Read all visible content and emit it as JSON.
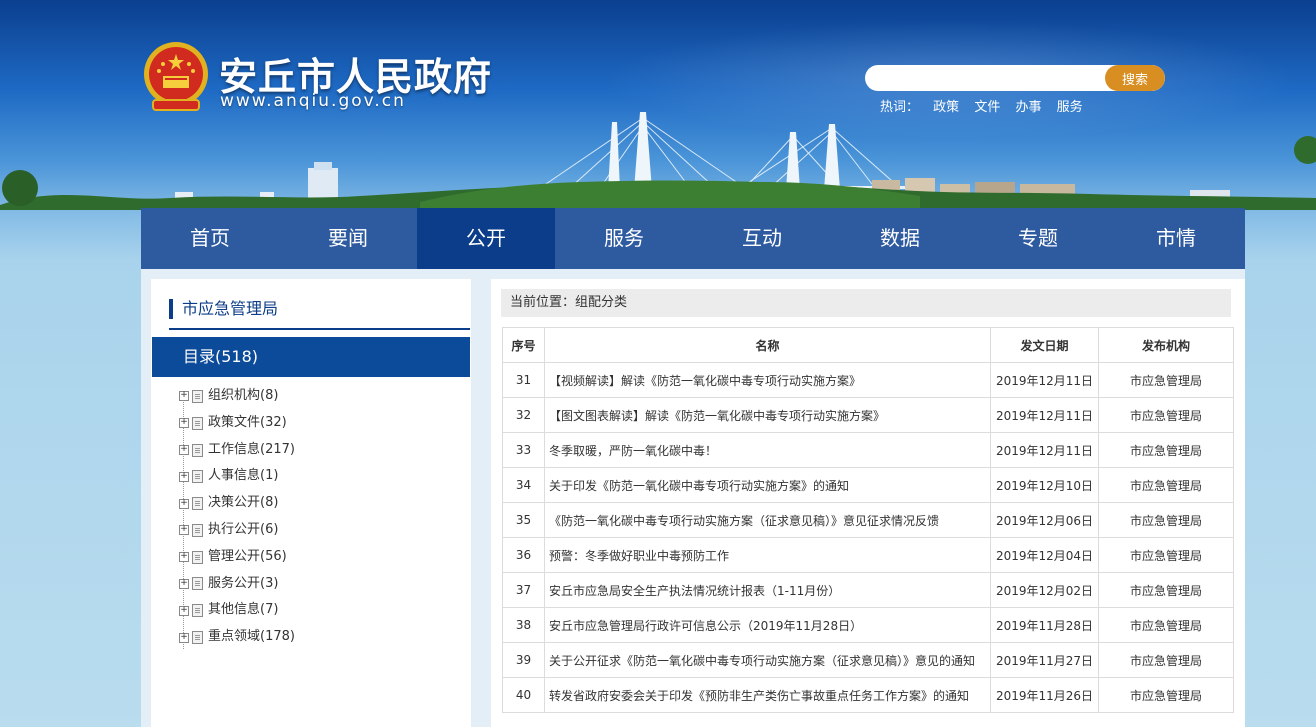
{
  "header": {
    "site_title": "安丘市人民政府",
    "site_url": "www.anqiu.gov.cn",
    "search": {
      "placeholder": "",
      "value": "",
      "button_label": "搜索"
    },
    "hotwords_label": "热词：",
    "hotwords": [
      "政策",
      "文件",
      "办事",
      "服务"
    ]
  },
  "nav": {
    "items": [
      "首页",
      "要闻",
      "公开",
      "服务",
      "互动",
      "数据",
      "专题",
      "市情"
    ],
    "active": "公开"
  },
  "sidebar": {
    "title": "市应急管理局",
    "directory": "目录(518)",
    "tree": [
      "组织机构(8)",
      "政策文件(32)",
      "工作信息(217)",
      "人事信息(1)",
      "决策公开(8)",
      "执行公开(6)",
      "管理公开(56)",
      "服务公开(3)",
      "其他信息(7)",
      "重点领域(178)"
    ]
  },
  "main": {
    "breadcrumb": "当前位置：组配分类",
    "columns": [
      "序号",
      "名称",
      "发文日期",
      "发布机构"
    ],
    "rows": [
      [
        "31",
        "【视频解读】解读《防范一氧化碳中毒专项行动实施方案》",
        "2019年12月11日",
        "市应急管理局"
      ],
      [
        "32",
        "【图文图表解读】解读《防范一氧化碳中毒专项行动实施方案》",
        "2019年12月11日",
        "市应急管理局"
      ],
      [
        "33",
        "冬季取暖，严防一氧化碳中毒！",
        "2019年12月11日",
        "市应急管理局"
      ],
      [
        "34",
        "关于印发《防范一氧化碳中毒专项行动实施方案》的通知",
        "2019年12月10日",
        "市应急管理局"
      ],
      [
        "35",
        "《防范一氧化碳中毒专项行动实施方案（征求意见稿）》意见征求情况反馈",
        "2019年12月06日",
        "市应急管理局"
      ],
      [
        "36",
        "预警：冬季做好职业中毒预防工作",
        "2019年12月04日",
        "市应急管理局"
      ],
      [
        "37",
        "安丘市应急局安全生产执法情况统计报表（1-11月份）",
        "2019年12月02日",
        "市应急管理局"
      ],
      [
        "38",
        "安丘市应急管理局行政许可信息公示（2019年11月28日）",
        "2019年11月28日",
        "市应急管理局"
      ],
      [
        "39",
        "关于公开征求《防范一氧化碳中毒专项行动实施方案（征求意见稿）》意见的通知",
        "2019年11月27日",
        "市应急管理局"
      ],
      [
        "40",
        "转发省政府安委会关于印发《预防非生产类伤亡事故重点任务工作方案》的通知",
        "2019年11月26日",
        "市应急管理局"
      ]
    ]
  },
  "colors": {
    "nav_bg": "#2e5aa0",
    "nav_active": "#0c3d8a",
    "search_button": "#d98e22",
    "directory_bg": "#0c4a9a"
  }
}
